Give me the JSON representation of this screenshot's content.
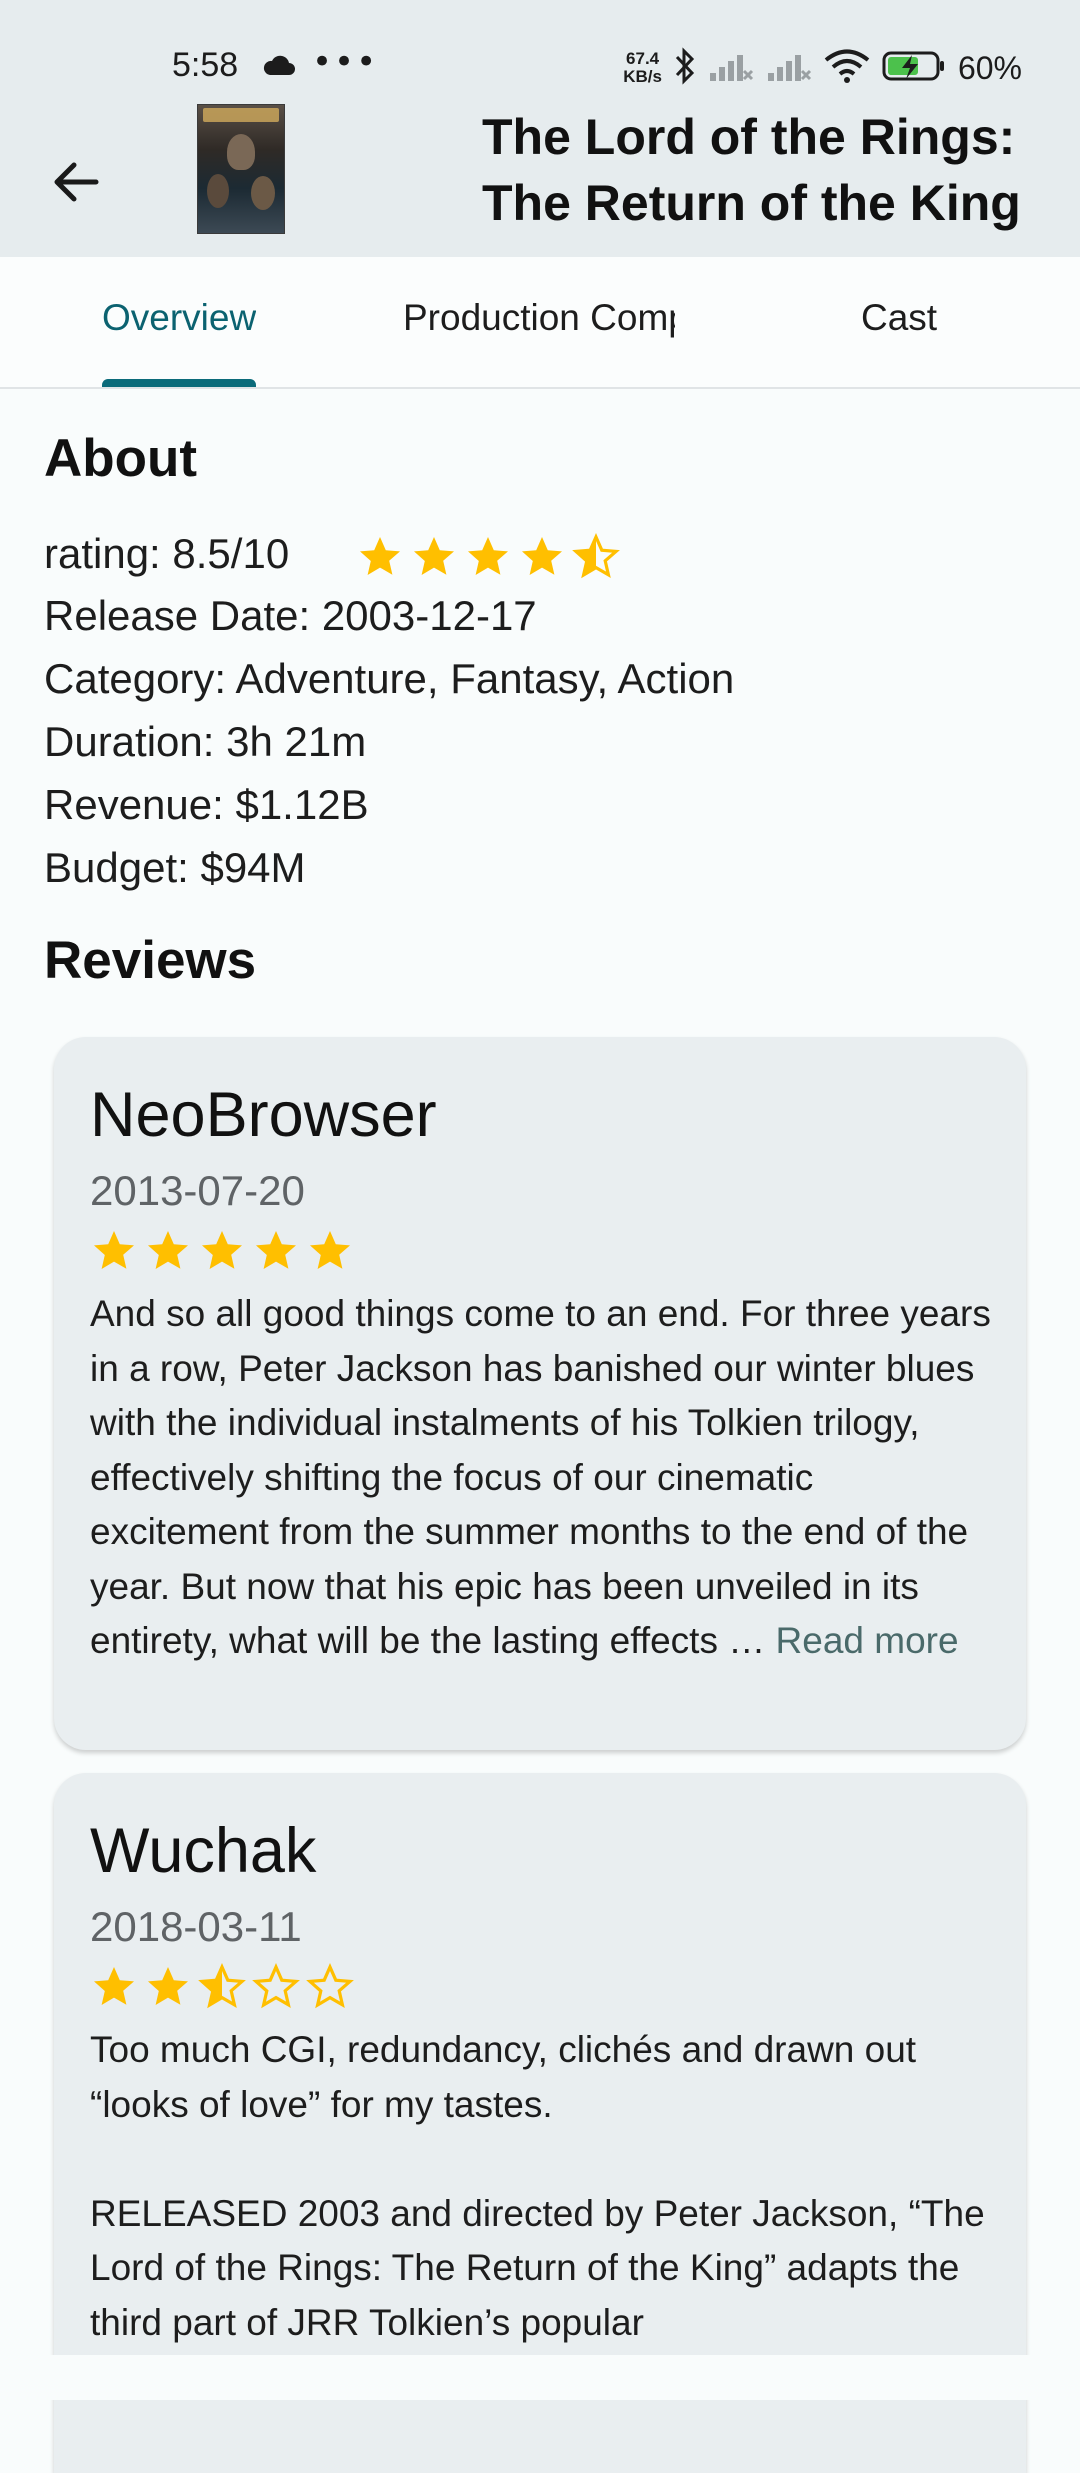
{
  "status_bar": {
    "time": "5:58",
    "net_speed_value": "67.4",
    "net_speed_unit": "KB/s",
    "battery": "60%"
  },
  "header": {
    "back_icon": "arrow-left-icon",
    "title": "The Lord of the Rings: The Return of the King"
  },
  "tabs": [
    {
      "label": "Overview",
      "active": true
    },
    {
      "label": "Production Companies",
      "active": false
    },
    {
      "label": "Cast",
      "active": false
    }
  ],
  "about": {
    "title": "About",
    "rating": "rating: 8.5/10",
    "rating_value": 4.5,
    "release_date": "Release Date: 2003-12-17",
    "category": "Category: Adventure, Fantasy, Action",
    "duration": "Duration: 3h 21m",
    "revenue": "Revenue: $1.12B",
    "budget": "Budget: $94M"
  },
  "reviews": {
    "title": "Reviews",
    "items": [
      {
        "author": "NeoBrowser",
        "date": "2013-07-20",
        "stars": 5,
        "text": "And so all good things come to an end. For three years in a row, Peter Jackson has banished our winter blues with the individual instalments of his Tolkien trilogy, effectively shifting the focus of our cinematic excitement from the summer months to the end of the year. But now that his epic has been unveiled in its entirety, what will be the lasting effects … ",
        "read_more": "Read more"
      },
      {
        "author": "Wuchak",
        "date": "2018-03-11",
        "stars": 2.5,
        "text": "Too much CGI, redundancy, clichés and drawn out “looks of love” for my tastes.\n\nRELEASED 2003 and directed by Peter Jackson, “The Lord of the Rings: The Return of the King” adapts the third part of JRR Tolkien’s popular"
      }
    ]
  },
  "colors": {
    "accent": "#0b6b7a",
    "star": "#ffbf00",
    "header_bg": "#e6ecee",
    "card_bg": "#e9eef0"
  }
}
